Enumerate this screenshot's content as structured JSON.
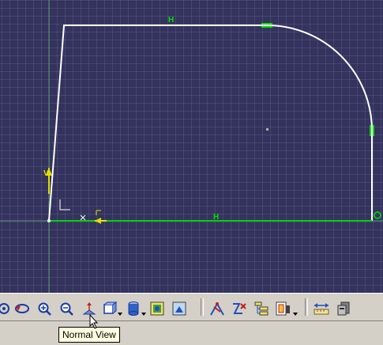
{
  "colors": {
    "background": "#33335e",
    "grid": "#5a5a8a",
    "profile_white": "#ffffff",
    "profile_green": "#00d000",
    "constraint_green": "#00e000",
    "axis_yellow": "#e0e000"
  },
  "sketch": {
    "constraint_labels": {
      "top_horizontal": "H",
      "bottom_horizontal": "H",
      "left_vertical": "V"
    }
  },
  "toolbar": {
    "buttons": [
      {
        "name": "pan-icon"
      },
      {
        "name": "rotate-icon"
      },
      {
        "name": "zoom-in-icon"
      },
      {
        "name": "zoom-out-icon"
      },
      {
        "name": "normal-view-icon"
      },
      {
        "name": "quick-view-icon"
      },
      {
        "name": "render-style-icon"
      },
      {
        "name": "hide-show-icon"
      },
      {
        "name": "swap-visible-space-icon"
      },
      {
        "name": "constraint-icon"
      },
      {
        "name": "analysis-icon"
      },
      {
        "name": "spec-tree-icon"
      },
      {
        "name": "sketch-analysis-icon"
      },
      {
        "name": "measure-icon"
      },
      {
        "name": "properties-icon"
      }
    ]
  },
  "tooltip": {
    "text": "Normal View"
  }
}
